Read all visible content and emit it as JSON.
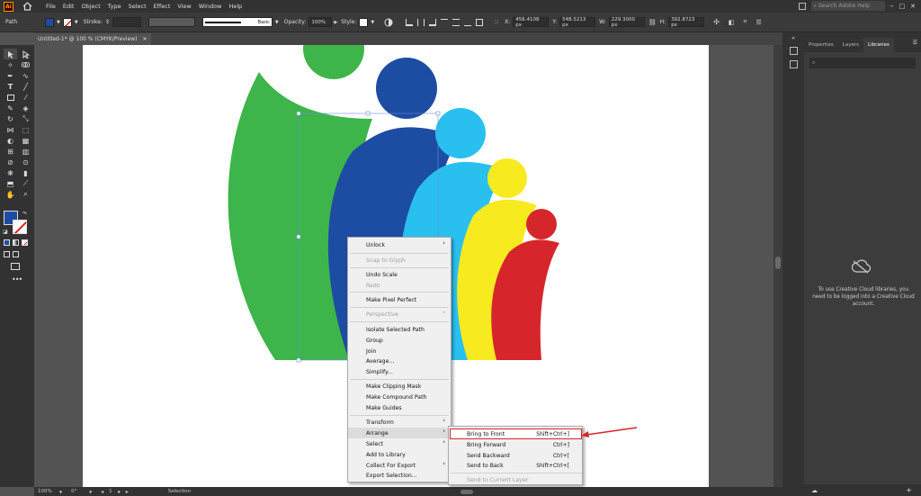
{
  "app": {
    "logo_text": "Ai"
  },
  "menubar": {
    "items": [
      "File",
      "Edit",
      "Object",
      "Type",
      "Select",
      "Effect",
      "View",
      "Window",
      "Help"
    ],
    "search_placeholder": "Search Adobe Help"
  },
  "controlbar": {
    "object_type": "Path",
    "fill_color": "#1d4ca3",
    "stroke_label": "Stroke:",
    "brush_label": "Basic",
    "opacity_label": "Opacity:",
    "opacity_value": "100%",
    "style_label": "Style:",
    "x_label": "X:",
    "x_value": "456.4108 px",
    "y_label": "Y:",
    "y_value": "548.5213 px",
    "w_label": "W:",
    "w_value": "229.3000 px",
    "h_label": "H:",
    "h_value": "392.8723 px"
  },
  "document": {
    "tab_title": "Untitled-1* @ 100 % (CMYK/Preview)"
  },
  "statusbar": {
    "zoom": "100%",
    "rotation": "0°",
    "artboard": "1",
    "tool": "Selection"
  },
  "panel": {
    "tabs": [
      "Properties",
      "Layers",
      "Libraries"
    ],
    "active_tab": "Libraries",
    "cc_message": "To use Creative Cloud libraries, you need to be logged into a Creative Cloud account."
  },
  "context_menu": {
    "unlock": "Unlock",
    "snap": "Snap to Glyph",
    "undo": "Undo Scale",
    "redo": "Redo",
    "pixel": "Make Pixel Perfect",
    "perspective": "Perspective",
    "isolate": "Isolate Selected Path",
    "group": "Group",
    "join": "Join",
    "average": "Average...",
    "simplify": "Simplify...",
    "clipping": "Make Clipping Mask",
    "compound": "Make Compound Path",
    "guides": "Make Guides",
    "transform": "Transform",
    "arrange": "Arrange",
    "select": "Select",
    "add_library": "Add to Library",
    "collect": "Collect For Export",
    "export": "Export Selection..."
  },
  "arrange_submenu": {
    "front": "Bring to Front",
    "front_sc": "Shift+Ctrl+]",
    "forward": "Bring Forward",
    "forward_sc": "Ctrl+]",
    "backward": "Send Backward",
    "backward_sc": "Ctrl+[",
    "back": "Send to Back",
    "back_sc": "Shift+Ctrl+[",
    "current_layer": "Send to Current Layer"
  },
  "colors": {
    "green": "#3db54a",
    "navy": "#1d4ca3",
    "cyan": "#29c0f0",
    "yellow": "#f7ea1f",
    "red": "#d6262b",
    "highlight": "#d8252c"
  }
}
